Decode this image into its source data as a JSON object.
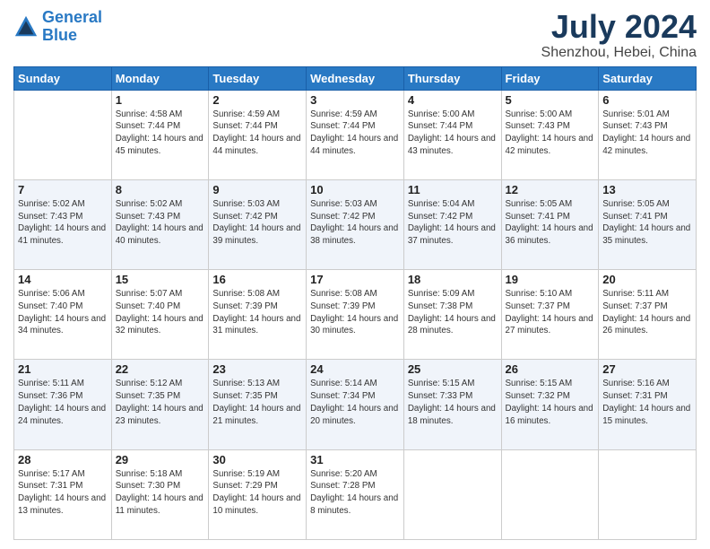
{
  "header": {
    "logo_line1": "General",
    "logo_line2": "Blue",
    "month": "July 2024",
    "location": "Shenzhou, Hebei, China"
  },
  "weekdays": [
    "Sunday",
    "Monday",
    "Tuesday",
    "Wednesday",
    "Thursday",
    "Friday",
    "Saturday"
  ],
  "weeks": [
    [
      {
        "day": "",
        "sunrise": "",
        "sunset": "",
        "daylight": ""
      },
      {
        "day": "1",
        "sunrise": "Sunrise: 4:58 AM",
        "sunset": "Sunset: 7:44 PM",
        "daylight": "Daylight: 14 hours and 45 minutes."
      },
      {
        "day": "2",
        "sunrise": "Sunrise: 4:59 AM",
        "sunset": "Sunset: 7:44 PM",
        "daylight": "Daylight: 14 hours and 44 minutes."
      },
      {
        "day": "3",
        "sunrise": "Sunrise: 4:59 AM",
        "sunset": "Sunset: 7:44 PM",
        "daylight": "Daylight: 14 hours and 44 minutes."
      },
      {
        "day": "4",
        "sunrise": "Sunrise: 5:00 AM",
        "sunset": "Sunset: 7:44 PM",
        "daylight": "Daylight: 14 hours and 43 minutes."
      },
      {
        "day": "5",
        "sunrise": "Sunrise: 5:00 AM",
        "sunset": "Sunset: 7:43 PM",
        "daylight": "Daylight: 14 hours and 42 minutes."
      },
      {
        "day": "6",
        "sunrise": "Sunrise: 5:01 AM",
        "sunset": "Sunset: 7:43 PM",
        "daylight": "Daylight: 14 hours and 42 minutes."
      }
    ],
    [
      {
        "day": "7",
        "sunrise": "Sunrise: 5:02 AM",
        "sunset": "Sunset: 7:43 PM",
        "daylight": "Daylight: 14 hours and 41 minutes."
      },
      {
        "day": "8",
        "sunrise": "Sunrise: 5:02 AM",
        "sunset": "Sunset: 7:43 PM",
        "daylight": "Daylight: 14 hours and 40 minutes."
      },
      {
        "day": "9",
        "sunrise": "Sunrise: 5:03 AM",
        "sunset": "Sunset: 7:42 PM",
        "daylight": "Daylight: 14 hours and 39 minutes."
      },
      {
        "day": "10",
        "sunrise": "Sunrise: 5:03 AM",
        "sunset": "Sunset: 7:42 PM",
        "daylight": "Daylight: 14 hours and 38 minutes."
      },
      {
        "day": "11",
        "sunrise": "Sunrise: 5:04 AM",
        "sunset": "Sunset: 7:42 PM",
        "daylight": "Daylight: 14 hours and 37 minutes."
      },
      {
        "day": "12",
        "sunrise": "Sunrise: 5:05 AM",
        "sunset": "Sunset: 7:41 PM",
        "daylight": "Daylight: 14 hours and 36 minutes."
      },
      {
        "day": "13",
        "sunrise": "Sunrise: 5:05 AM",
        "sunset": "Sunset: 7:41 PM",
        "daylight": "Daylight: 14 hours and 35 minutes."
      }
    ],
    [
      {
        "day": "14",
        "sunrise": "Sunrise: 5:06 AM",
        "sunset": "Sunset: 7:40 PM",
        "daylight": "Daylight: 14 hours and 34 minutes."
      },
      {
        "day": "15",
        "sunrise": "Sunrise: 5:07 AM",
        "sunset": "Sunset: 7:40 PM",
        "daylight": "Daylight: 14 hours and 32 minutes."
      },
      {
        "day": "16",
        "sunrise": "Sunrise: 5:08 AM",
        "sunset": "Sunset: 7:39 PM",
        "daylight": "Daylight: 14 hours and 31 minutes."
      },
      {
        "day": "17",
        "sunrise": "Sunrise: 5:08 AM",
        "sunset": "Sunset: 7:39 PM",
        "daylight": "Daylight: 14 hours and 30 minutes."
      },
      {
        "day": "18",
        "sunrise": "Sunrise: 5:09 AM",
        "sunset": "Sunset: 7:38 PM",
        "daylight": "Daylight: 14 hours and 28 minutes."
      },
      {
        "day": "19",
        "sunrise": "Sunrise: 5:10 AM",
        "sunset": "Sunset: 7:37 PM",
        "daylight": "Daylight: 14 hours and 27 minutes."
      },
      {
        "day": "20",
        "sunrise": "Sunrise: 5:11 AM",
        "sunset": "Sunset: 7:37 PM",
        "daylight": "Daylight: 14 hours and 26 minutes."
      }
    ],
    [
      {
        "day": "21",
        "sunrise": "Sunrise: 5:11 AM",
        "sunset": "Sunset: 7:36 PM",
        "daylight": "Daylight: 14 hours and 24 minutes."
      },
      {
        "day": "22",
        "sunrise": "Sunrise: 5:12 AM",
        "sunset": "Sunset: 7:35 PM",
        "daylight": "Daylight: 14 hours and 23 minutes."
      },
      {
        "day": "23",
        "sunrise": "Sunrise: 5:13 AM",
        "sunset": "Sunset: 7:35 PM",
        "daylight": "Daylight: 14 hours and 21 minutes."
      },
      {
        "day": "24",
        "sunrise": "Sunrise: 5:14 AM",
        "sunset": "Sunset: 7:34 PM",
        "daylight": "Daylight: 14 hours and 20 minutes."
      },
      {
        "day": "25",
        "sunrise": "Sunrise: 5:15 AM",
        "sunset": "Sunset: 7:33 PM",
        "daylight": "Daylight: 14 hours and 18 minutes."
      },
      {
        "day": "26",
        "sunrise": "Sunrise: 5:15 AM",
        "sunset": "Sunset: 7:32 PM",
        "daylight": "Daylight: 14 hours and 16 minutes."
      },
      {
        "day": "27",
        "sunrise": "Sunrise: 5:16 AM",
        "sunset": "Sunset: 7:31 PM",
        "daylight": "Daylight: 14 hours and 15 minutes."
      }
    ],
    [
      {
        "day": "28",
        "sunrise": "Sunrise: 5:17 AM",
        "sunset": "Sunset: 7:31 PM",
        "daylight": "Daylight: 14 hours and 13 minutes."
      },
      {
        "day": "29",
        "sunrise": "Sunrise: 5:18 AM",
        "sunset": "Sunset: 7:30 PM",
        "daylight": "Daylight: 14 hours and 11 minutes."
      },
      {
        "day": "30",
        "sunrise": "Sunrise: 5:19 AM",
        "sunset": "Sunset: 7:29 PM",
        "daylight": "Daylight: 14 hours and 10 minutes."
      },
      {
        "day": "31",
        "sunrise": "Sunrise: 5:20 AM",
        "sunset": "Sunset: 7:28 PM",
        "daylight": "Daylight: 14 hours and 8 minutes."
      },
      {
        "day": "",
        "sunrise": "",
        "sunset": "",
        "daylight": ""
      },
      {
        "day": "",
        "sunrise": "",
        "sunset": "",
        "daylight": ""
      },
      {
        "day": "",
        "sunrise": "",
        "sunset": "",
        "daylight": ""
      }
    ]
  ]
}
